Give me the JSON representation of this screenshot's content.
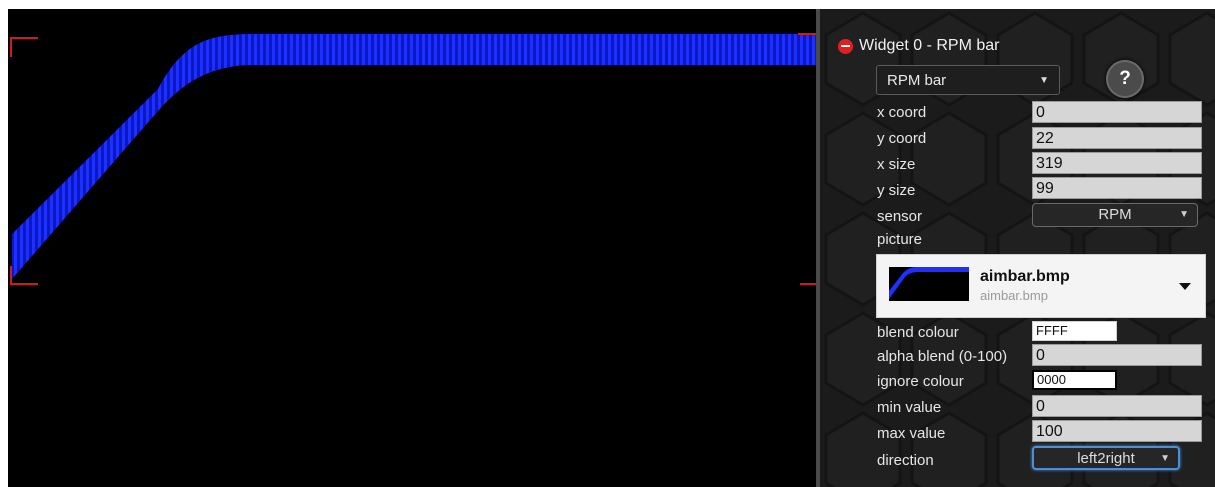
{
  "preview": {
    "image_name": "aimbar.bmp",
    "bar_color": "#1a2bff",
    "frame_color": "#cc1c1c",
    "background_color": "#000000"
  },
  "panel": {
    "widget_title": "Widget 0 - RPM bar",
    "widget_type": "RPM bar",
    "help_label": "?",
    "fields": {
      "x_coord": {
        "label": "x coord",
        "value": "0"
      },
      "y_coord": {
        "label": "y coord",
        "value": "22"
      },
      "x_size": {
        "label": "x size",
        "value": "319"
      },
      "y_size": {
        "label": "y size",
        "value": "99"
      },
      "sensor": {
        "label": "sensor",
        "value": "RPM"
      },
      "picture": {
        "label": "picture"
      },
      "blend_colour": {
        "label": "blend colour",
        "value": "FFFF"
      },
      "alpha_blend": {
        "label": "alpha blend (0-100)",
        "value": "0"
      },
      "ignore_colour": {
        "label": "ignore colour",
        "value": "0000"
      },
      "min_value": {
        "label": "min value",
        "value": "0"
      },
      "max_value": {
        "label": "max value",
        "value": "100"
      },
      "direction": {
        "label": "direction",
        "value": "left2right"
      }
    },
    "picture_picker": {
      "title": "aimbar.bmp",
      "subtitle": "aimbar.bmp"
    }
  },
  "icons": {
    "remove_widget": "minus-circle-icon",
    "type_dropdown": "chevron-down-icon",
    "picker_dropdown": "caret-down-icon",
    "help": "help-icon"
  }
}
